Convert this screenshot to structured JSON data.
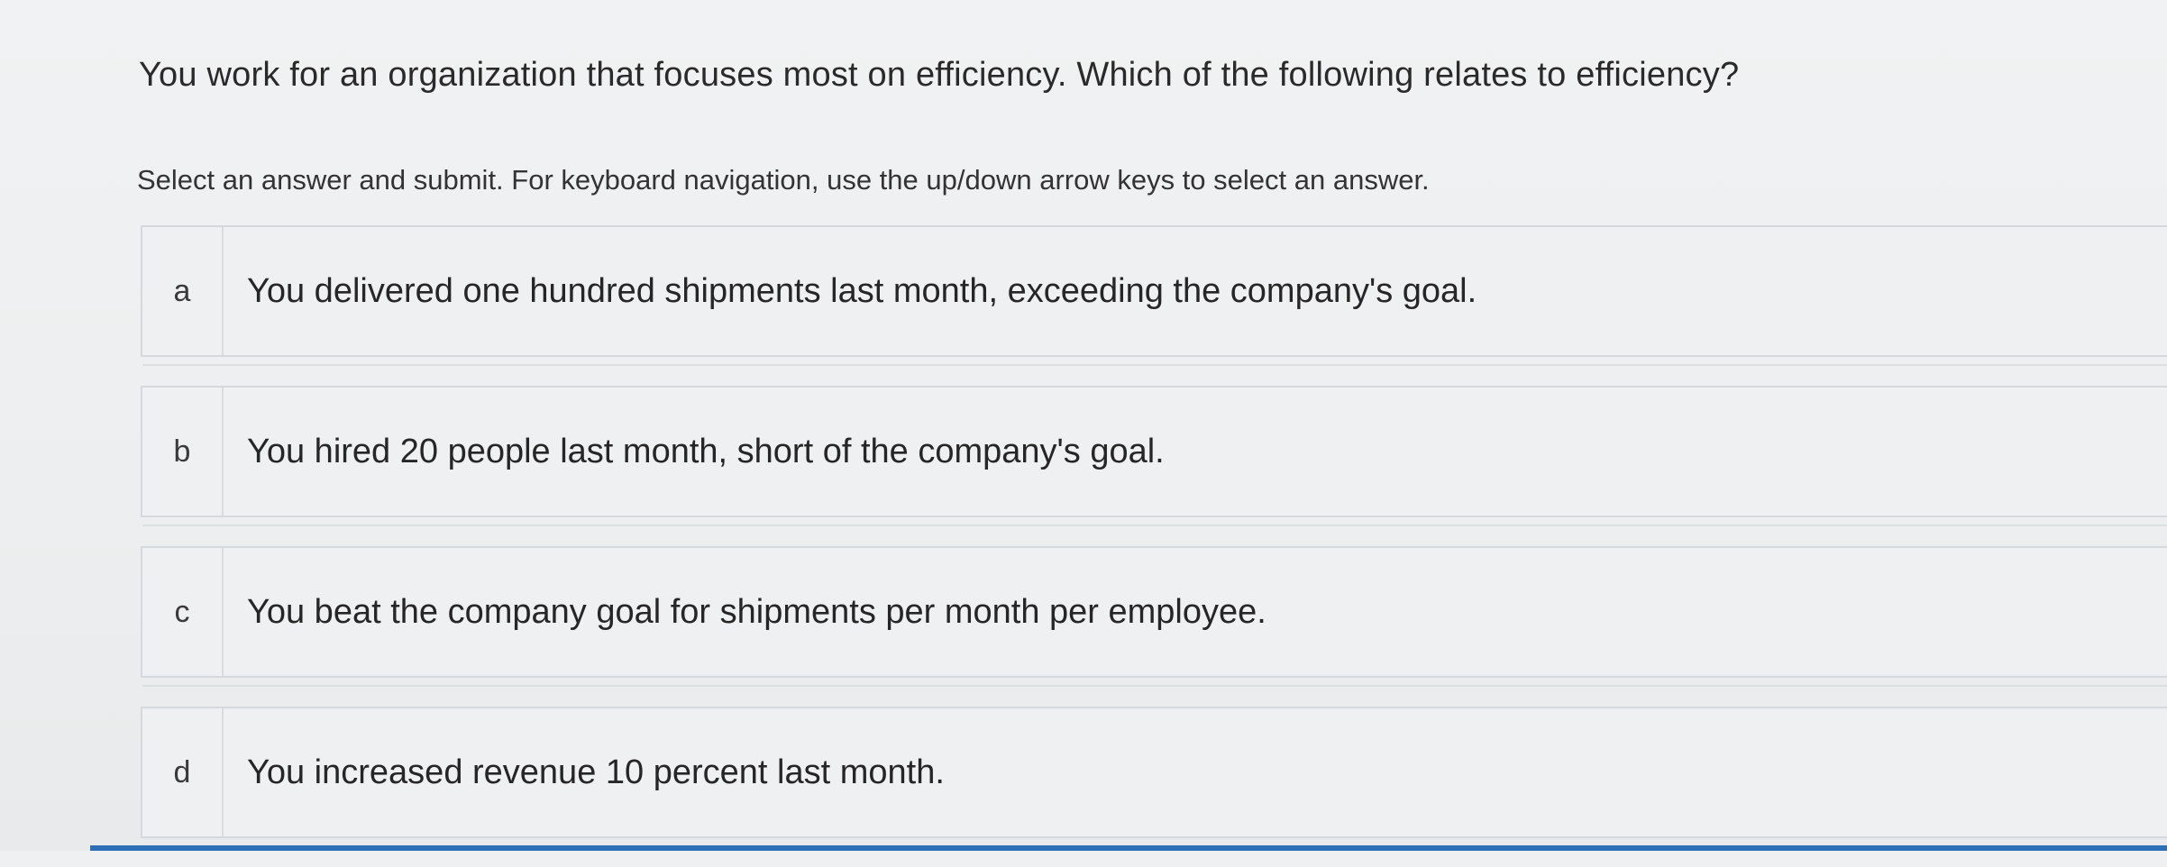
{
  "question": {
    "text": "You work for an organization that focuses most on efficiency. Which of the following relates to efficiency?"
  },
  "instructions": "Select an answer and submit. For keyboard navigation, use the up/down arrow keys to select an answer.",
  "options": [
    {
      "letter": "a",
      "text": "You delivered one hundred shipments last month, exceeding the company's goal."
    },
    {
      "letter": "b",
      "text": "You hired 20 people last month, short of the company's goal."
    },
    {
      "letter": "c",
      "text": "You beat the company goal for shipments per month per employee."
    },
    {
      "letter": "d",
      "text": "You increased revenue 10 percent last month."
    }
  ],
  "colors": {
    "background": "#eef0f1",
    "border": "#d6d9db",
    "text": "#2a2a2a",
    "accent_bar": "#2d6fb6"
  }
}
